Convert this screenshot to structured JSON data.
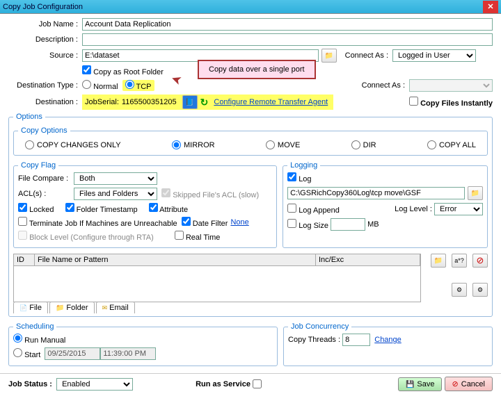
{
  "title": "Copy Job Configuration",
  "labels": {
    "jobName": "Job Name :",
    "description": "Description :",
    "source": "Source :",
    "connectAs": "Connect As :",
    "copyAsRoot": "Copy as Root Folder",
    "destType": "Destination Type :",
    "normal": "Normal",
    "tcp": "TCP",
    "destination": "Destination :",
    "jobSerial": "JobSerial:",
    "configRemote": "Configure Remote Transfer Agent",
    "copyInstantly": "Copy Files Instantly",
    "options": "Options",
    "copyOptions": "Copy Options",
    "copyChanges": "COPY CHANGES ONLY",
    "mirror": "MIRROR",
    "move": "MOVE",
    "dir": "DIR",
    "copyAll": "COPY ALL",
    "copyFlag": "Copy Flag",
    "fileCompare": "File Compare :",
    "acls": "ACL(s) :",
    "skipped": "Skipped File's ACL (slow)",
    "locked": "Locked",
    "folderTs": "Folder Timestamp",
    "attribute": "Attribute",
    "terminate": "Terminate Job If Machines are Unreachable",
    "dateFilter": "Date Filter",
    "none": "None",
    "blockLevel": "Block Level (Configure through RTA)",
    "realTime": "Real Time",
    "logging": "Logging",
    "log": "Log",
    "logAppend": "Log Append",
    "logLevel": "Log Level :",
    "logSize": "Log Size",
    "mb": "MB",
    "id": "ID",
    "fileName": "File Name or Pattern",
    "incExc": "Inc/Exc",
    "tabFile": "File",
    "tabFolder": "Folder",
    "tabEmail": "Email",
    "scheduling": "Scheduling",
    "runManual": "Run Manual",
    "start": "Start",
    "jobConcurrency": "Job Concurrency",
    "copyThreads": "Copy Threads :",
    "change": "Change",
    "jobStatus": "Job Status :",
    "runAsService": "Run as Service",
    "save": "Save",
    "cancel": "Cancel"
  },
  "values": {
    "jobName": "Account Data Replication",
    "source": "E:\\dataset",
    "connectAs1": "Logged in User",
    "serial": "1165500351205",
    "fileCompare": "Both",
    "acls": "Files and Folders",
    "logPath": "C:\\GSRichCopy360Log\\tcp move\\GSF",
    "logLevel": "Error",
    "date": "09/25/2015",
    "time": "11:39:00 PM",
    "threads": "8",
    "jobStatus": "Enabled"
  },
  "callout": "Copy data over a single port"
}
